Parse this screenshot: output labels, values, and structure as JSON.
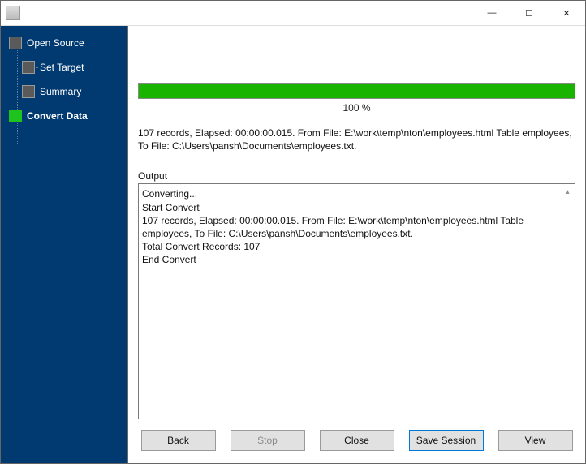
{
  "window": {
    "minimize_glyph": "—",
    "maximize_glyph": "☐",
    "close_glyph": "✕"
  },
  "sidebar": {
    "items": [
      {
        "label": "Open Source"
      },
      {
        "label": "Set Target"
      },
      {
        "label": "Summary"
      },
      {
        "label": "Convert Data"
      }
    ]
  },
  "progress": {
    "percent": 100,
    "label": "100 %"
  },
  "summary": {
    "line1": "107 records,    Elapsed: 00:00:00.015.    From File: E:\\work\\temp\\nton\\employees.html Table employees,",
    "line2": "To File: C:\\Users\\pansh\\Documents\\employees.txt."
  },
  "output": {
    "label": "Output",
    "lines": [
      "Converting...",
      "Start Convert",
      "107 records,    Elapsed: 00:00:00.015.    From File: E:\\work\\temp\\nton\\employees.html Table employees,    To File: C:\\Users\\pansh\\Documents\\employees.txt.",
      "Total Convert Records: 107",
      "End Convert"
    ],
    "scroll_up_glyph": "▴"
  },
  "buttons": {
    "back": "Back",
    "stop": "Stop",
    "close": "Close",
    "save_session": "Save Session",
    "view": "View"
  }
}
